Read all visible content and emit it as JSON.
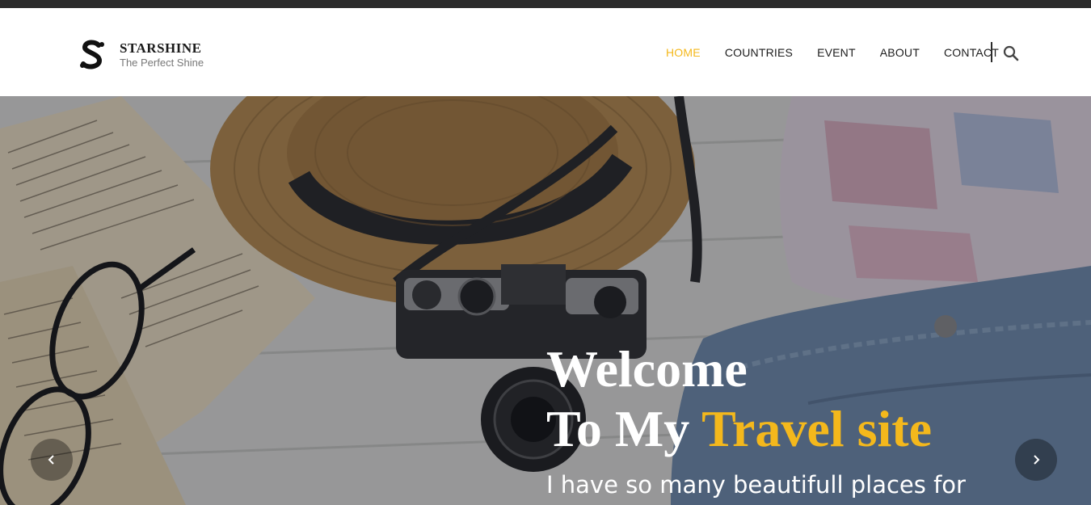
{
  "brand": {
    "name": "STARSHINE",
    "tagline": "The Perfect Shine",
    "logo_icon": "s-logo-icon"
  },
  "nav": {
    "items": [
      {
        "label": "HOME",
        "active": true
      },
      {
        "label": "COUNTRIES",
        "active": false
      },
      {
        "label": "EVENT",
        "active": false
      },
      {
        "label": "ABOUT",
        "active": false
      },
      {
        "label": "CONTACT",
        "active": false
      }
    ],
    "search_icon": "search-icon"
  },
  "hero": {
    "title_line1": "Welcome",
    "title_line2_plain": "To My ",
    "title_line2_accent": "Travel site",
    "subtitle": "I have so many beautifull places for",
    "prev_icon": "chevron-left-icon",
    "next_icon": "chevron-right-icon"
  },
  "colors": {
    "accent": "#f4b81c",
    "topbar": "#2b2b2b",
    "text": "#1c1c1c"
  }
}
